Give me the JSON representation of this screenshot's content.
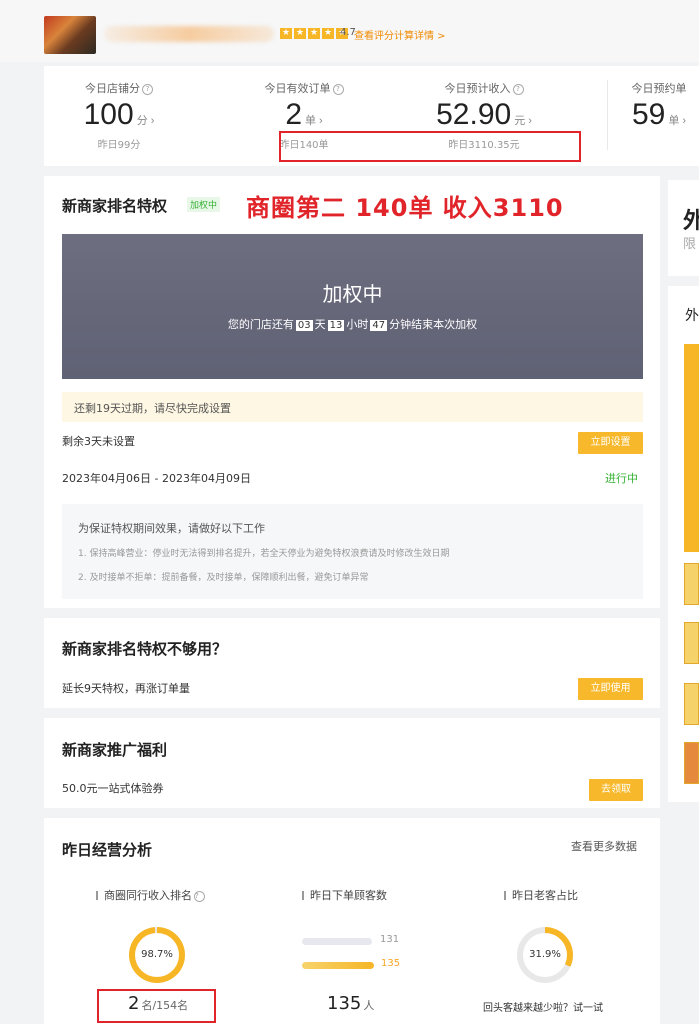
{
  "header": {
    "rating": "4.7",
    "rating_link": "查看评分计算详情 >",
    "stars": [
      "★",
      "★",
      "★",
      "★",
      "★"
    ]
  },
  "stats": [
    {
      "label": "今日店铺分",
      "value": "100",
      "unit": "分",
      "sub": "昨日99分"
    },
    {
      "label": "今日有效订单",
      "value": "2",
      "unit": "单",
      "sub": "昨日140单"
    },
    {
      "label": "今日预计收入",
      "value": "52.90",
      "unit": "元",
      "sub": "昨日3110.35元"
    },
    {
      "label": "今日预约单",
      "value": "59",
      "unit": "单"
    }
  ],
  "rank_card": {
    "title": "新商家排名特权",
    "badge": "加权中",
    "annotation": "商圈第二  140单  收入3110",
    "box_title": "加权中",
    "box_text_prefix": "您的门店还有",
    "days": "03",
    "days_unit": "天",
    "hours": "13",
    "hours_unit": "小时",
    "minutes": "47",
    "box_text_suffix": "分钟结束本次加权",
    "warn": "还剩19天过期，请尽快完成设置",
    "remaining": "剩余3天未设置",
    "setup_button": "立即设置",
    "date_range": "2023年04月06日 - 2023年04月09日",
    "status": "进行中",
    "tips_heading": "为保证特权期间效果，请做好以下工作",
    "tips": [
      "1. 保持高峰营业：停业时无法得到排名提升，若全天停业为避免特权浪费请及时修改生效日期",
      "2. 及时接单不拒单：提前备餐，及时接单，保障顺利出餐，避免订单异常"
    ]
  },
  "card2": {
    "title": "新商家排名特权不够用？",
    "text": "延长9天特权，再涨订单量",
    "button": "立即使用"
  },
  "card3": {
    "title": "新商家推广福利",
    "text": "50.0元一站式体验券",
    "button": "去领取"
  },
  "analysis": {
    "title": "昨日经营分析",
    "more": "查看更多数据",
    "rank_label": "商圈同行收入排名",
    "rank_percent": "98.7%",
    "rank_percent_value": 98.7,
    "rank_value": "2",
    "rank_unit": "名/154名",
    "customers_label": "昨日下单顾客数",
    "bar1_value": "131",
    "bar2_value": "135",
    "customers_value": "135",
    "customers_unit": "人",
    "repeat_label": "昨日老客占比",
    "repeat_percent": "31.9%",
    "repeat_percent_value": 31.9,
    "repeat_text": "回头客越来越少啦？试一试"
  },
  "side": {
    "char1": "外",
    "char2": "限",
    "char3": "外"
  },
  "colors": {
    "accent": "#f7b92b",
    "annotation_red": "#e0242a",
    "status_green": "#34b233"
  }
}
